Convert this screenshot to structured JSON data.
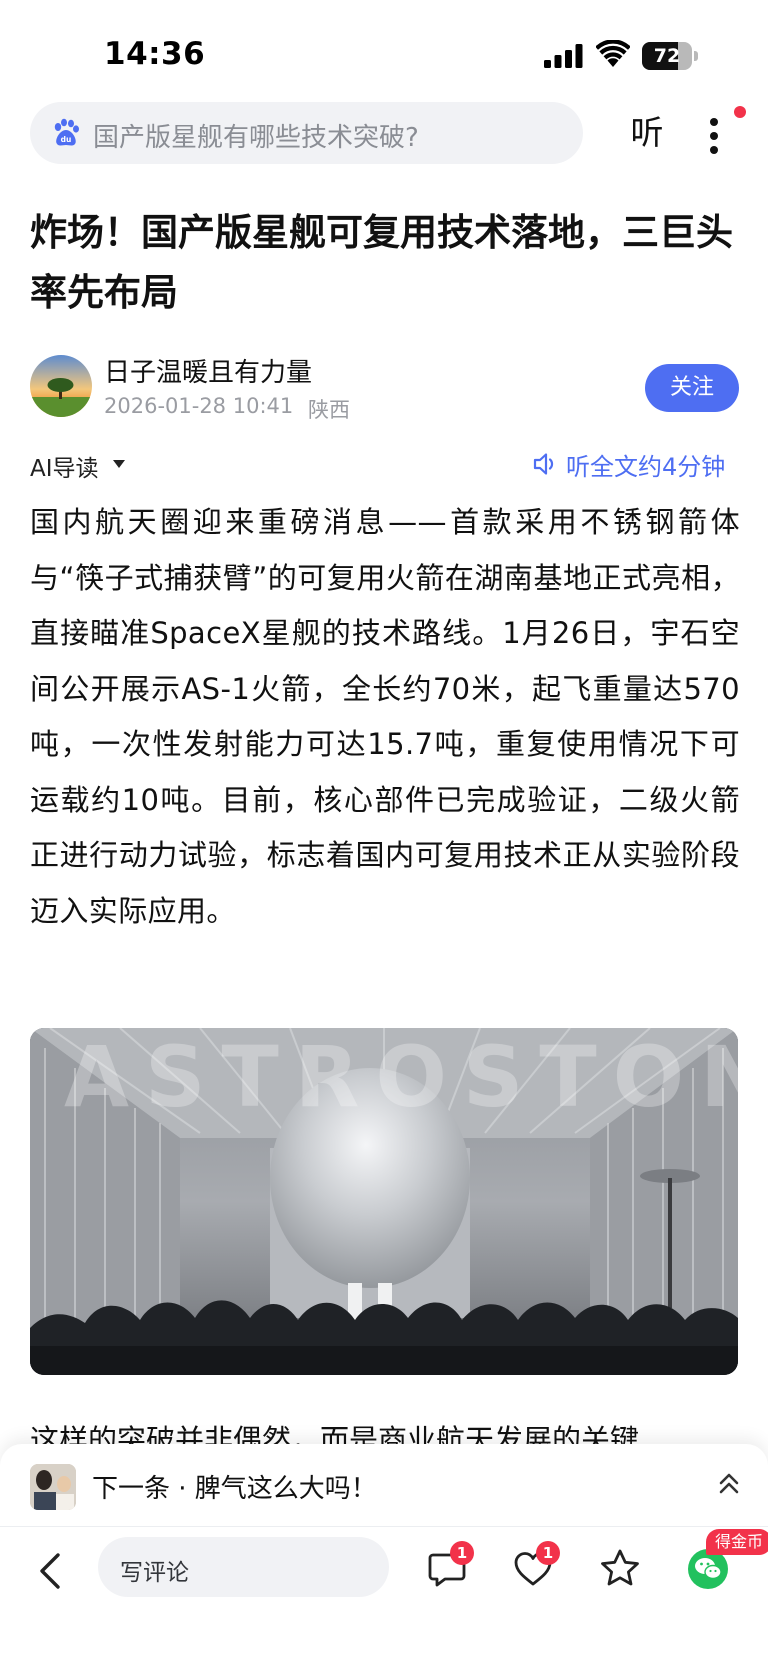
{
  "status_bar": {
    "time": "14:36",
    "battery_percent": "72",
    "battery_level": 0.72
  },
  "header": {
    "search_placeholder": "国产版星舰有哪些技术突破?",
    "listen_label": "听"
  },
  "article": {
    "title": "炸场！国产版星舰可复用技术落地，三巨头率先布局",
    "author": "日子温暖且有力量",
    "publish_time": "2026-01-28 10:41",
    "location": "陕西",
    "follow_label": "关注",
    "ai_guide_label": "AI导读",
    "listen_full_label": "听全文约4分钟",
    "paragraph_1": "国内航天圈迎来重磅消息——首款采用不锈钢箭体与“筷子式捕获臂”的可复用火箭在湖南基地正式亮相，直接瞄准SpaceX星舰的技术路线。1月26日，宇石空间公开展示AS-1火箭，全长约70米，起飞重量达570吨，一次性发射能力可达15.7吨，重复使用情况下可运载约10吨。目前，核心部件已完成验证，二级火箭正进行动力试验，标志着国内可复用技术正从实验阶段迈入实际应用。",
    "photo_watermark": "ASTROSTONE",
    "paragraph_2_partial": "这样的突破并非偶然，而是商业航天发展的关键"
  },
  "next_bar": {
    "label": "下一条 · 脾气这么大吗！"
  },
  "bottom_bar": {
    "comment_placeholder": "写评论",
    "comment_count": "1",
    "like_count": "1",
    "coin_label": "得金币"
  },
  "colors": {
    "accent": "#4e6ef2",
    "badge": "#f2324a",
    "wechat": "#22c15e"
  }
}
